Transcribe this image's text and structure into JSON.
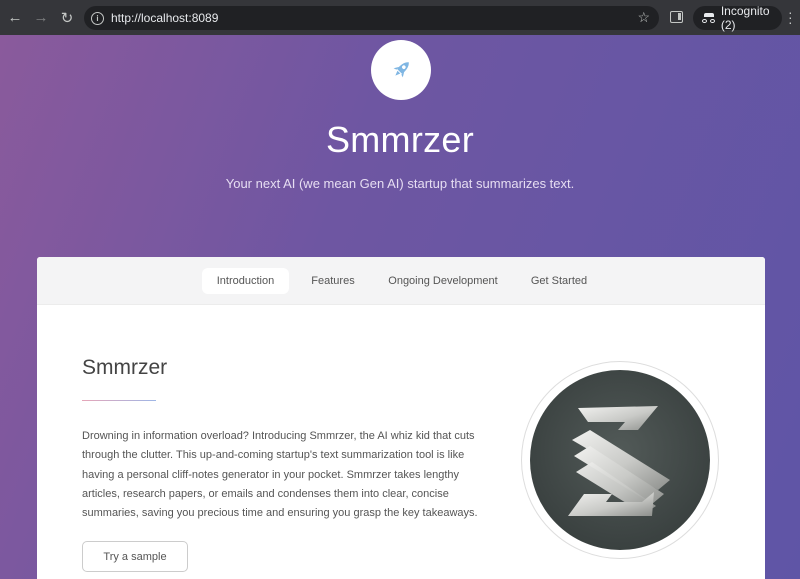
{
  "browser": {
    "url": "http://localhost:8089",
    "incognito_label": "Incognito (2)",
    "icons": [
      "back-arrow-icon",
      "forward-arrow-icon",
      "reload-icon",
      "info-icon",
      "star-icon",
      "side-panel-icon",
      "incognito-icon",
      "more-icon"
    ]
  },
  "hero": {
    "logo_icon": "rocket-icon",
    "title": "Smmrzer",
    "subtitle": "Your next AI (we mean Gen AI) startup that summarizes text."
  },
  "tabs": [
    {
      "label": "Introduction",
      "active": true
    },
    {
      "label": "Features",
      "active": false
    },
    {
      "label": "Ongoing Development",
      "active": false
    },
    {
      "label": "Get Started",
      "active": false
    }
  ],
  "intro": {
    "title": "Smmrzer",
    "body": "Drowning in information overload? Introducing Smmrzer, the AI whiz kid that cuts through the clutter. This up-and-coming startup's text summarization tool is like having a personal cliff-notes generator in your pocket. Smmrzer takes lengthy articles, research papers, or emails and condenses them into clear, concise summaries, saving you precious time and ensuring you grasp the key takeaways.",
    "button": "Try a sample",
    "image": "smmrzer-logo-image"
  },
  "colors": {
    "gradient_start": "#8a5a9c",
    "gradient_end": "#5f55a6",
    "rocket": "#7fb6e3"
  }
}
